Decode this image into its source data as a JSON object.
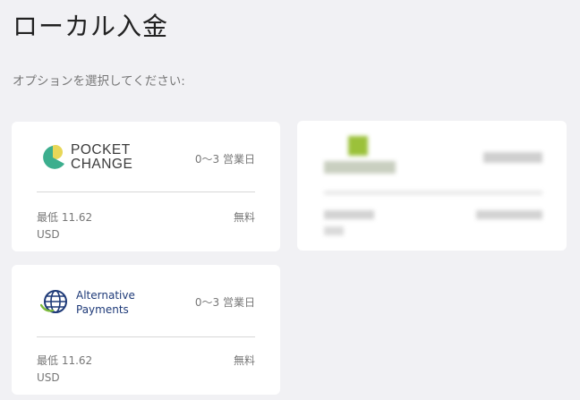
{
  "page": {
    "title": "ローカル入金",
    "subtitle": "オプションを選択してください:"
  },
  "options": [
    {
      "id": "pocketchange",
      "logo_text_line1": "POCKET",
      "logo_text_line2": "CHANGE",
      "time": "0〜3 営業日",
      "min_label": "最低 11.62",
      "min_currency": "USD",
      "fee": "無料"
    },
    {
      "id": "alternative-payments",
      "logo_text_line1": "Alternative",
      "logo_text_line2": "Payments",
      "time": "0〜3 営業日",
      "min_label": "最低 11.62",
      "min_currency": "USD",
      "fee": "無料"
    }
  ],
  "colors": {
    "background": "#f1f1f4",
    "card": "#ffffff",
    "pocketchange_green": "#3cae8e",
    "pocketchange_yellow": "#e8d758",
    "ap_navy": "#1e3a78",
    "ap_green": "#7dbb3c"
  }
}
